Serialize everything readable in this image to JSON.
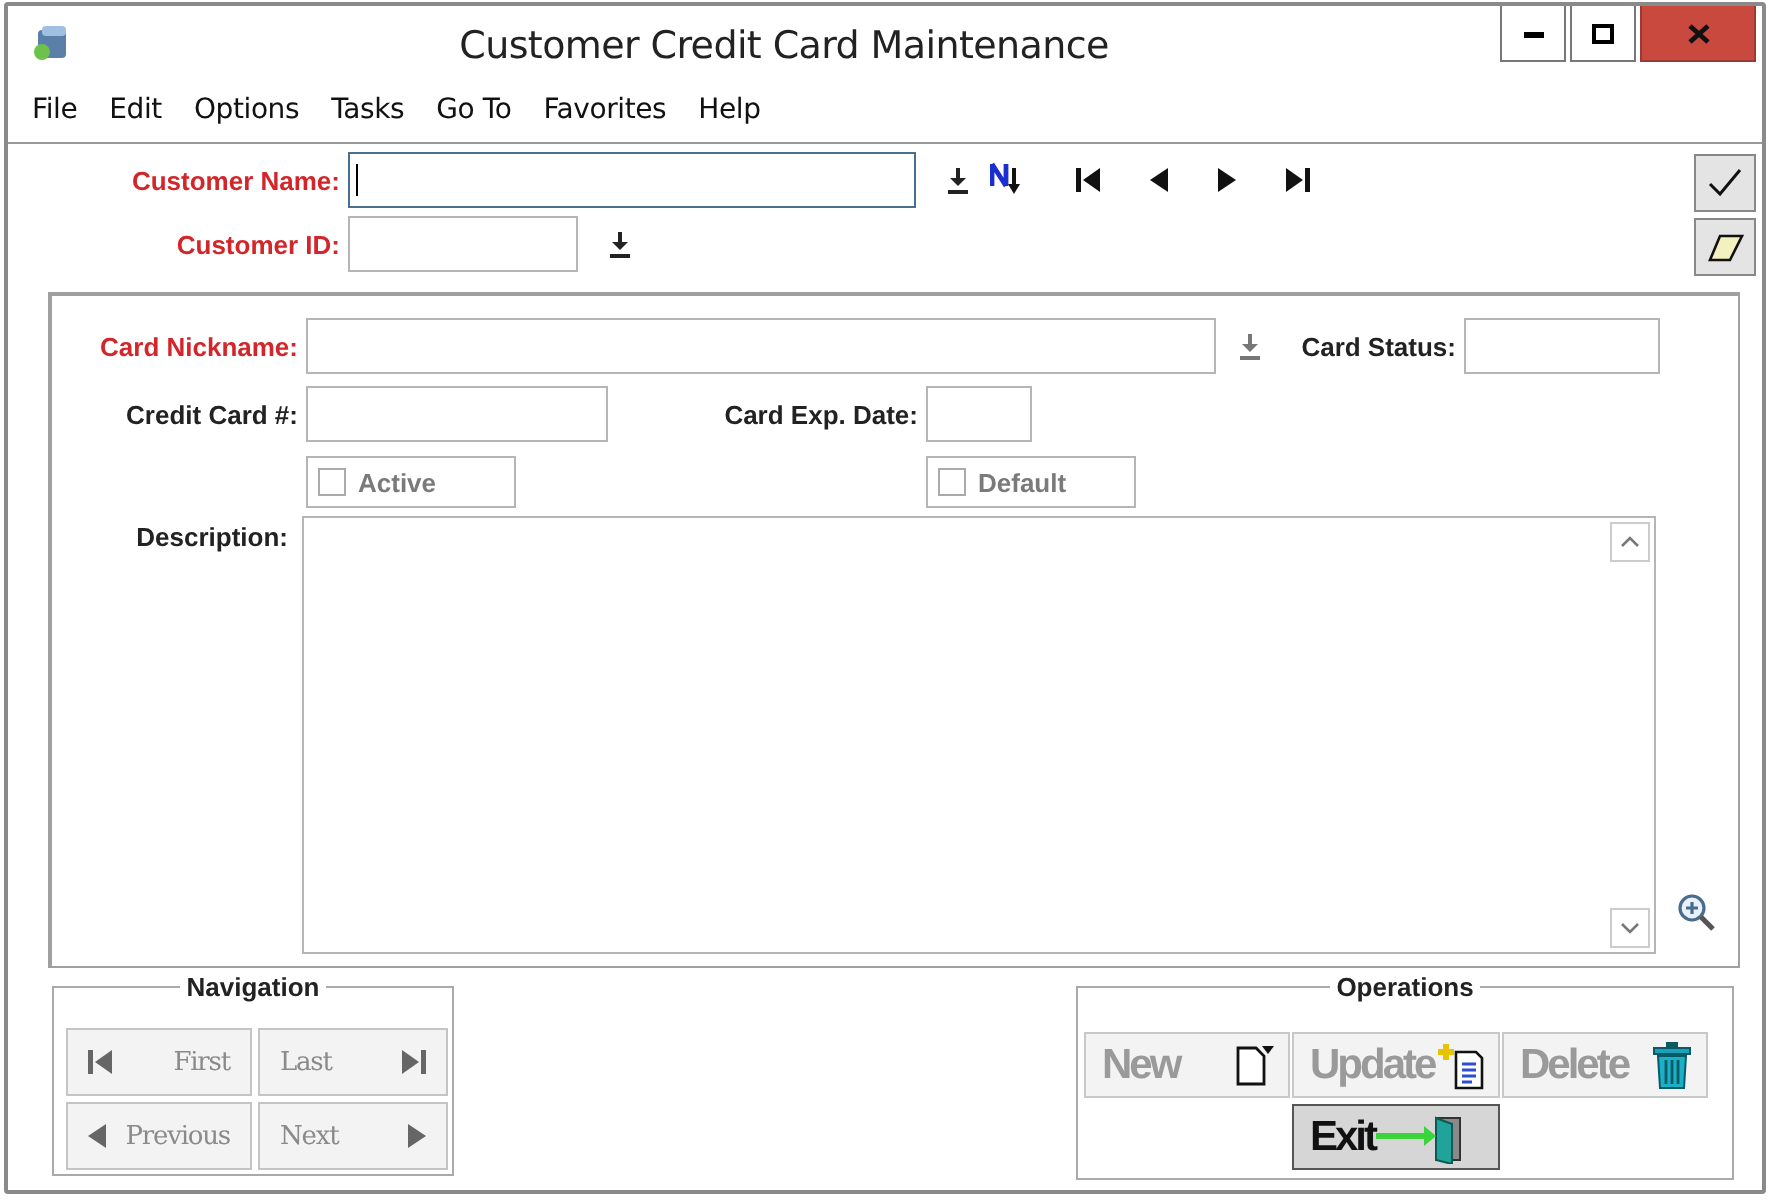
{
  "window": {
    "title": "Customer Credit Card Maintenance"
  },
  "menu": [
    "File",
    "Edit",
    "Options",
    "Tasks",
    "Go To",
    "Favorites",
    "Help"
  ],
  "customer_fields": [
    {
      "label": "Customer Name:",
      "required": true,
      "focused": true
    },
    {
      "label": "Customer ID:",
      "required": true,
      "focused": false
    }
  ],
  "card_fields": [
    {
      "label": "Card Nickname:",
      "required": true
    },
    {
      "label": "Card Status:",
      "required": false
    },
    {
      "label": "Credit Card #:",
      "required": false
    },
    {
      "label": "Card Exp. Date:",
      "required": false
    }
  ],
  "checkboxes": [
    {
      "label": "Active",
      "checked": false,
      "disabled": true
    },
    {
      "label": "Default",
      "checked": false,
      "disabled": true
    }
  ],
  "description": {
    "label": "Description:"
  },
  "navigation": {
    "title": "Navigation",
    "buttons": [
      {
        "label": "First",
        "disabled": true
      },
      {
        "label": "Last",
        "disabled": true
      },
      {
        "label": "Previous",
        "disabled": true
      },
      {
        "label": "Next",
        "disabled": true
      }
    ]
  },
  "operations": {
    "title": "Operations",
    "buttons": [
      {
        "label": "New",
        "disabled": true
      },
      {
        "label": "Update",
        "disabled": true
      },
      {
        "label": "Delete",
        "disabled": true
      },
      {
        "label": "Exit",
        "disabled": false
      }
    ]
  }
}
